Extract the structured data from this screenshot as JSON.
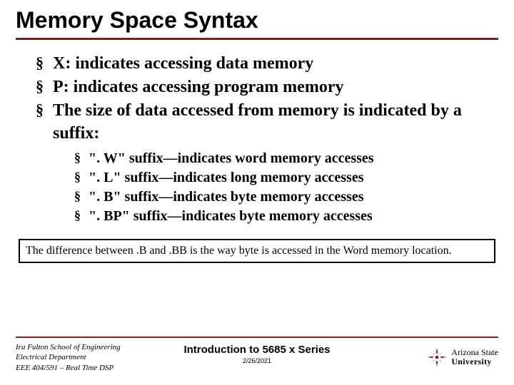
{
  "title": "Memory Space Syntax",
  "bullets": {
    "b1": "X: indicates accessing data memory",
    "b2": "P: indicates accessing program memory",
    "b3": "The size of data accessed from memory is indicated by a suffix:",
    "sub": {
      "s1": "\". W\" suffix—indicates word memory accesses",
      "s2": "\". L\" suffix—indicates long memory accesses",
      "s3": "\". B\" suffix—indicates byte memory accesses",
      "s4": "\". BP\" suffix—indicates byte memory accesses"
    }
  },
  "note": "The difference between .B and .BB is the way byte is accessed in the Word memory location.",
  "footer": {
    "left": {
      "l1": "Ira Fulton School of Engineering",
      "l2": "Electrical Department",
      "l3": "EEE 404/591 – Real Time DSP"
    },
    "center": {
      "title": "Introduction to 5685 x Series",
      "date": "2/26/2021"
    },
    "logo": {
      "l1": "Arizona State",
      "l2": "University"
    }
  }
}
